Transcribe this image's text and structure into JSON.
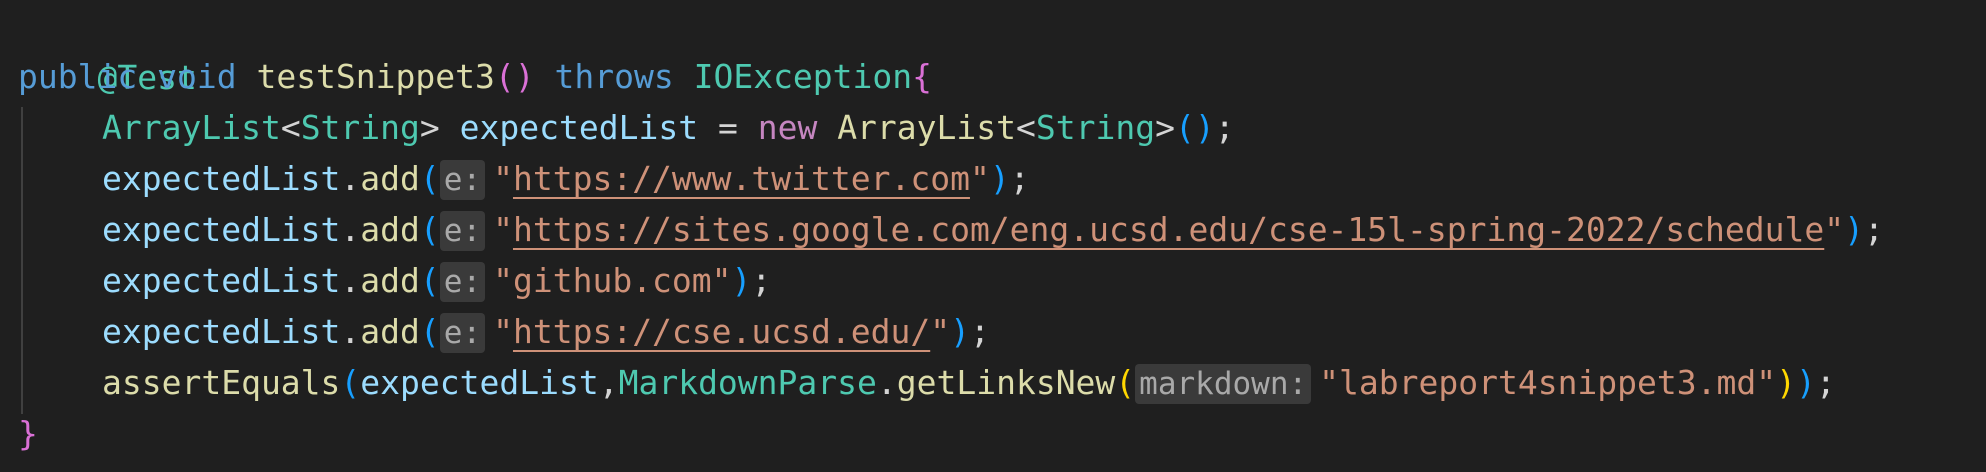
{
  "code": {
    "line1": {
      "annotation": "@Test"
    },
    "line2": {
      "kw_public": "public",
      "kw_void": "void",
      "method_name": "testSnippet3",
      "parens": "()",
      "kw_throws": "throws",
      "exception": "IOException",
      "brace_open": "{"
    },
    "line3": {
      "type": "ArrayList",
      "lt": "<",
      "generic": "String",
      "gt": ">",
      "var": "expectedList",
      "eq": "=",
      "kw_new": "new",
      "ctor": "ArrayList",
      "lt2": "<",
      "generic2": "String",
      "gt2": ">",
      "parens": "()",
      "semi": ";"
    },
    "add_lines": [
      {
        "var": "expectedList",
        "dot": ".",
        "method": "add",
        "open": "(",
        "hint": "e:",
        "q1": "\"",
        "value": "https://www.twitter.com",
        "q2": "\"",
        "close": ")",
        "semi": ";"
      },
      {
        "var": "expectedList",
        "dot": ".",
        "method": "add",
        "open": "(",
        "hint": "e:",
        "q1": "\"",
        "value": "https://sites.google.com/eng.ucsd.edu/cse-15l-spring-2022/schedule",
        "q2": "\"",
        "close": ")",
        "semi": ";"
      },
      {
        "var": "expectedList",
        "dot": ".",
        "method": "add",
        "open": "(",
        "hint": "e:",
        "literal": "\"github.com\"",
        "close": ")",
        "semi": ";"
      },
      {
        "var": "expectedList",
        "dot": ".",
        "method": "add",
        "open": "(",
        "hint": "e:",
        "q1": "\"",
        "value": "https://cse.ucsd.edu/",
        "q2": "\"",
        "close": ")",
        "semi": ";"
      }
    ],
    "line8": {
      "fn": "assertEquals",
      "open": "(",
      "arg1": "expectedList",
      "comma": ",",
      "class": "MarkdownParse",
      "dot": ".",
      "method": "getLinksNew",
      "open2": "(",
      "hint": "markdown:",
      "literal": "\"labreport4snippet3.md\"",
      "close2": ")",
      "close": ")",
      "semi": ";"
    },
    "line9": {
      "brace_close": "}"
    }
  }
}
